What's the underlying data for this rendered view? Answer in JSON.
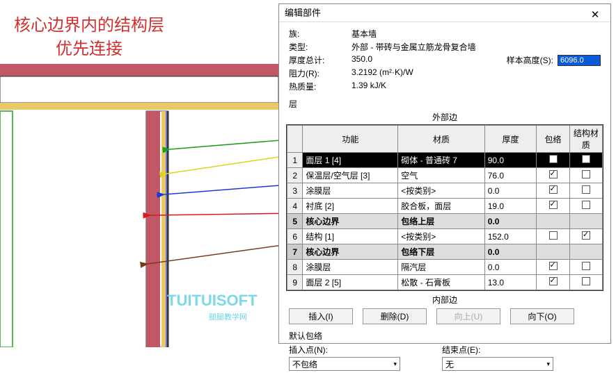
{
  "annotation": {
    "line1": "核心边界内的结构层",
    "line2": "优先连接"
  },
  "dialog": {
    "title": "编辑部件",
    "close": "✕",
    "props": {
      "family_lbl": "族:",
      "family_val": "基本墙",
      "type_lbl": "类型:",
      "type_val": "外部 - 带砖与金属立筋龙骨复合墙",
      "total_lbl": "厚度总计:",
      "total_val": "350.0",
      "sample_lbl": "样本高度(S):",
      "sample_val": "6096.0",
      "r_lbl": "阻力(R):",
      "r_val": "3.2192 (m²·K)/W",
      "mass_lbl": "热质量:",
      "mass_val": "1.39 kJ/K"
    },
    "layers_lbl": "层",
    "outer_lbl": "外部边",
    "inner_lbl": "内部边",
    "headers": {
      "func": "功能",
      "mat": "材质",
      "thk": "厚度",
      "wrap": "包络",
      "struct": "结构材质"
    },
    "rows": [
      {
        "n": "1",
        "func": "面层 1 [4]",
        "mat": "砌体 - 普通砖 7",
        "thk": "90.0",
        "wrap": true,
        "struct": false,
        "sel": true
      },
      {
        "n": "2",
        "func": "保温层/空气层 [3]",
        "mat": "空气",
        "thk": "76.0",
        "wrap": true,
        "struct": false
      },
      {
        "n": "3",
        "func": "涂膜层",
        "mat": "<按类别>",
        "thk": "0.0",
        "wrap": true,
        "struct": false
      },
      {
        "n": "4",
        "func": "衬底 [2]",
        "mat": "胶合板，面层",
        "thk": "19.0",
        "wrap": true,
        "struct": false
      },
      {
        "n": "5",
        "func": "核心边界",
        "mat": "包络上层",
        "thk": "0.0",
        "core": true
      },
      {
        "n": "6",
        "func": "结构 [1]",
        "mat": "<按类别>",
        "thk": "152.0",
        "wrap": false,
        "struct": true
      },
      {
        "n": "7",
        "func": "核心边界",
        "mat": "包络下层",
        "thk": "0.0",
        "core": true
      },
      {
        "n": "8",
        "func": "涂膜层",
        "mat": "隔汽层",
        "thk": "0.0",
        "wrap": true,
        "struct": false
      },
      {
        "n": "9",
        "func": "面层 2 [5]",
        "mat": "松散 - 石膏板",
        "thk": "13.0",
        "wrap": true,
        "struct": false
      }
    ],
    "buttons": {
      "insert": "插入(I)",
      "delete": "删除(D)",
      "up": "向上(U)",
      "down": "向下(O)"
    },
    "default_wrap": "默认包络",
    "insert_pt_lbl": "插入点(N):",
    "insert_pt_val": "不包络",
    "end_pt_lbl": "结束点(E):",
    "end_pt_val": "无"
  },
  "watermark": {
    "main": "TUITUISOFT",
    "sub": "腿腿教学网"
  }
}
